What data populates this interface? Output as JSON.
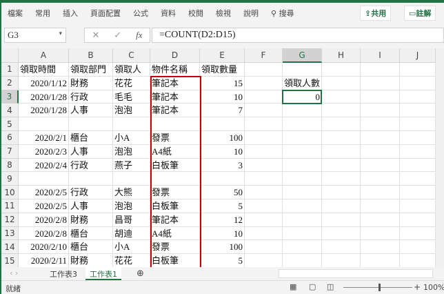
{
  "ribbon": {
    "tabs": [
      "檔案",
      "常用",
      "插入",
      "頁面配置",
      "公式",
      "資料",
      "校閱",
      "檢視",
      "說明"
    ],
    "search": "搜尋",
    "share": "共用",
    "comment": "註解"
  },
  "formula_bar": {
    "name_box": "G3",
    "formula": "=COUNT(D2:D15)",
    "fx": "fx"
  },
  "columns": [
    "A",
    "B",
    "C",
    "D",
    "E",
    "F",
    "G",
    "H",
    "I",
    "J"
  ],
  "rows": [
    [
      "領取時間",
      "領取部門",
      "領取人",
      "物件名稱",
      "領取數量",
      "",
      "",
      "",
      "",
      ""
    ],
    [
      "2020/1/12",
      "財務",
      "花花",
      "筆記本",
      "15",
      "",
      "領取人數",
      "",
      "",
      ""
    ],
    [
      "2020/1/28",
      "行政",
      "毛毛",
      "筆記本",
      "10",
      "",
      "0",
      "",
      "",
      ""
    ],
    [
      "2020/1/28",
      "人事",
      "泡泡",
      "筆記本",
      "7",
      "",
      "",
      "",
      "",
      ""
    ],
    [
      "",
      "",
      "",
      "",
      "",
      "",
      "",
      "",
      "",
      ""
    ],
    [
      "2020/2/1",
      "櫃台",
      "小A",
      "發票",
      "100",
      "",
      "",
      "",
      "",
      ""
    ],
    [
      "2020/2/3",
      "人事",
      "泡泡",
      "A4紙",
      "10",
      "",
      "",
      "",
      "",
      ""
    ],
    [
      "2020/2/4",
      "行政",
      "燕子",
      "白板筆",
      "3",
      "",
      "",
      "",
      "",
      ""
    ],
    [
      "",
      "",
      "",
      "",
      "",
      "",
      "",
      "",
      "",
      ""
    ],
    [
      "2020/2/5",
      "行政",
      "大熊",
      "發票",
      "50",
      "",
      "",
      "",
      "",
      ""
    ],
    [
      "2020/2/5",
      "人事",
      "泡泡",
      "白板筆",
      "5",
      "",
      "",
      "",
      "",
      ""
    ],
    [
      "2020/2/8",
      "財務",
      "昌哥",
      "筆記本",
      "12",
      "",
      "",
      "",
      "",
      ""
    ],
    [
      "2020/2/8",
      "櫃台",
      "胡迪",
      "A4紙",
      "10",
      "",
      "",
      "",
      "",
      ""
    ],
    [
      "2020/2/10",
      "櫃台",
      "小A",
      "發票",
      "100",
      "",
      "",
      "",
      "",
      ""
    ],
    [
      "2020/2/11",
      "財務",
      "花花",
      "白板筆",
      "5",
      "",
      "",
      "",
      "",
      ""
    ]
  ],
  "sheets": [
    "工作表3",
    "工作表1"
  ],
  "active_sheet": "工作表1",
  "status": {
    "text": "就緒",
    "zoom": "100%"
  },
  "colors": {
    "accent": "#217346",
    "highlight": "#c00000"
  }
}
